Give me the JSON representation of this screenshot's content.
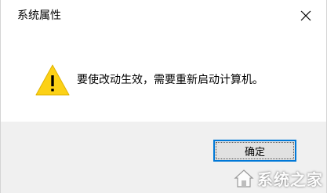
{
  "window": {
    "title": "系统属性"
  },
  "dialog": {
    "message": "要使改动生效，需要重新启动计算机。",
    "icon": "warning-icon"
  },
  "buttons": {
    "ok_label": "确定"
  },
  "watermark": {
    "text": "系统之家",
    "icon": "system-home-logo"
  },
  "colors": {
    "accent": "#0078d7",
    "warning_fill": "#fcd116",
    "footer_bg": "#f0f0f0"
  }
}
